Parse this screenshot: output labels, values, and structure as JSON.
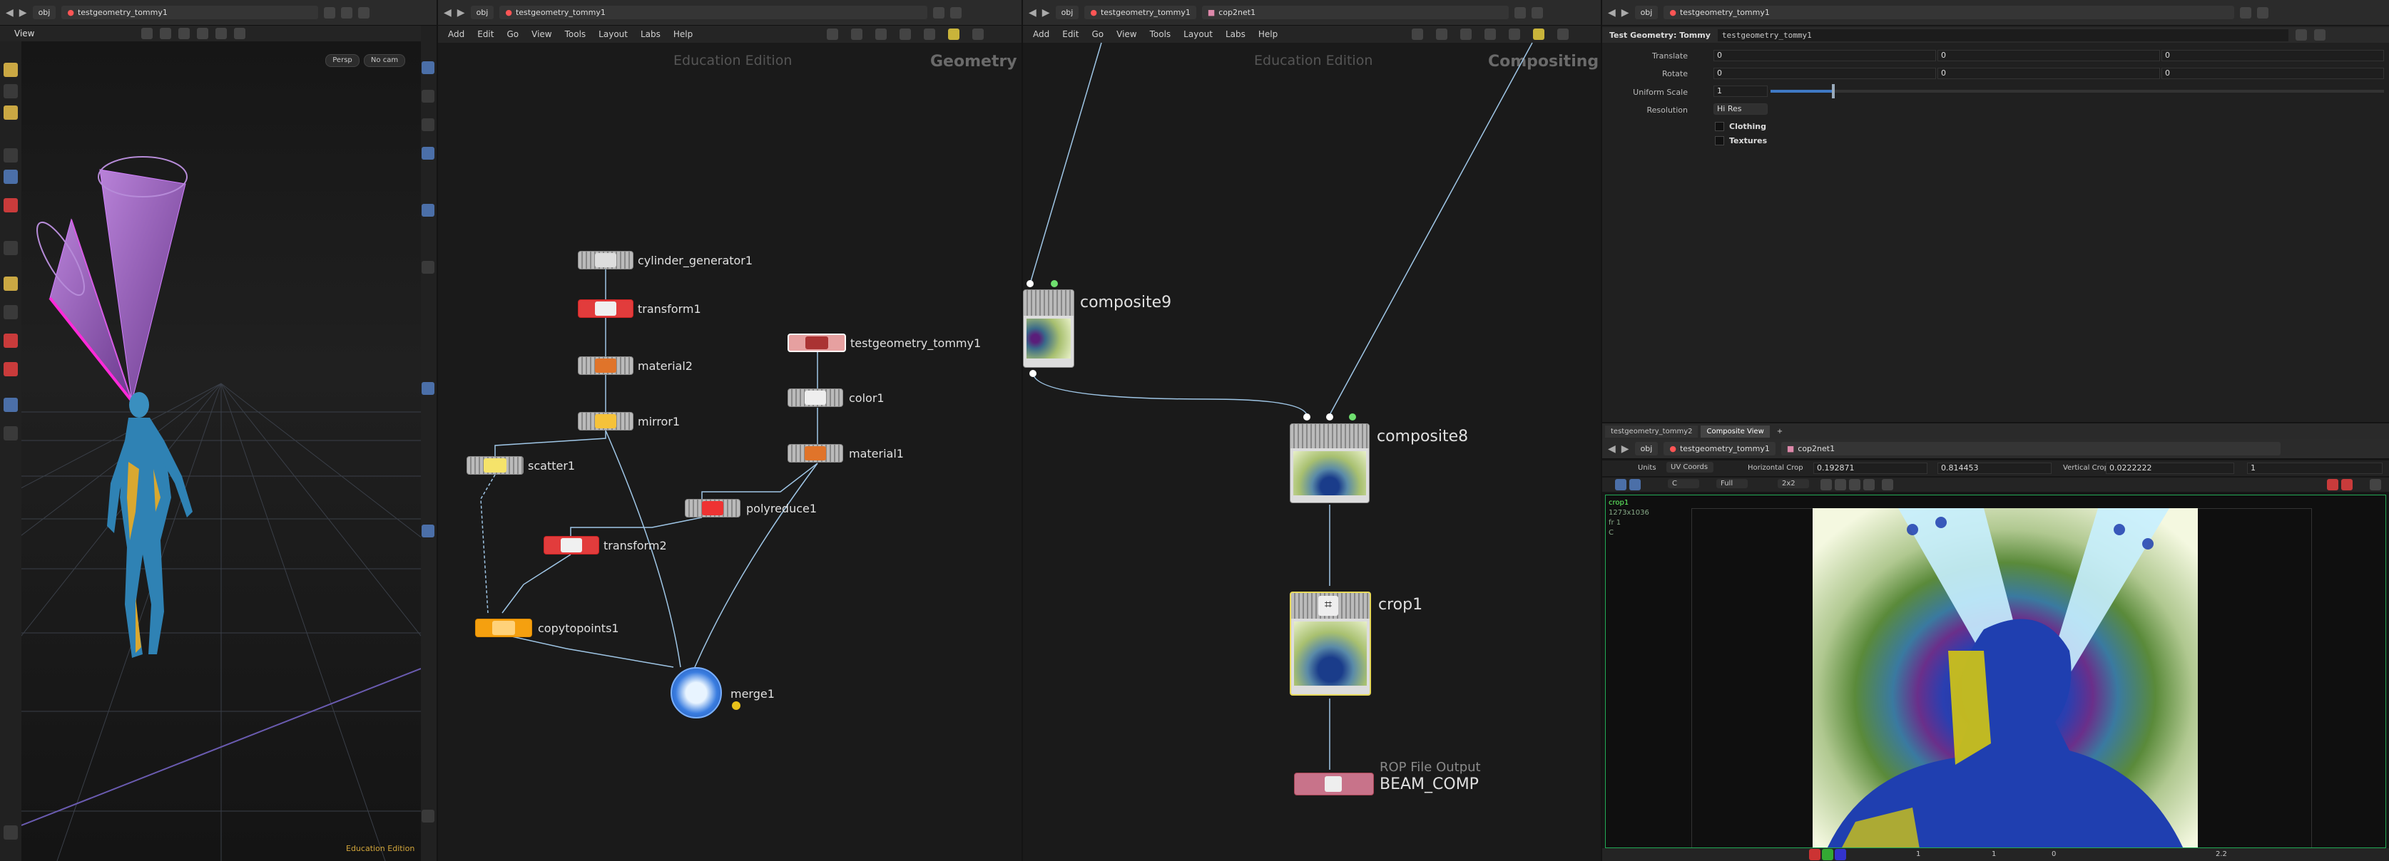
{
  "viewport": {
    "path": {
      "root": "obj",
      "node": "testgeometry_tommy1"
    },
    "title": "View",
    "persp": "Persp",
    "cam": "No cam",
    "edition": "Education Edition"
  },
  "network_geo": {
    "path": {
      "root": "obj",
      "node": "testgeometry_tommy1"
    },
    "menu": [
      "Add",
      "Edit",
      "Go",
      "View",
      "Tools",
      "Layout",
      "Labs",
      "Help"
    ],
    "edition": "Education Edition",
    "context": "Geometry",
    "nodes": {
      "cylinder": "cylinder_generator1",
      "transform1": "transform1",
      "material2": "material2",
      "mirror1": "mirror1",
      "scatter1": "scatter1",
      "transform2": "transform2",
      "copytopoints1": "copytopoints1",
      "merge1": "merge1",
      "testgeo": "testgeometry_tommy1",
      "color1": "color1",
      "material1": "material1",
      "polyreduce1": "polyreduce1"
    }
  },
  "network_comp": {
    "path": {
      "root": "obj",
      "node": "testgeometry_tommy1",
      "net": "cop2net1"
    },
    "menu": [
      "Add",
      "Edit",
      "Go",
      "View",
      "Tools",
      "Layout",
      "Labs",
      "Help"
    ],
    "edition": "Education Edition",
    "context": "Compositing",
    "nodes": {
      "composite9": "composite9",
      "composite8": "composite8",
      "crop1": "crop1",
      "rop_type": "ROP File Output",
      "beam": "BEAM_COMP"
    }
  },
  "params": {
    "path": {
      "root": "obj",
      "node": "testgeometry_tommy1"
    },
    "node_type": "Test Geometry: Tommy",
    "node_name": "testgeometry_tommy1",
    "translate_label": "Translate",
    "translate": [
      "0",
      "0",
      "0"
    ],
    "rotate_label": "Rotate",
    "rotate": [
      "0",
      "0",
      "0"
    ],
    "scale_label": "Uniform Scale",
    "scale": "1",
    "scale_fraction": 0.1,
    "resolution_label": "Resolution",
    "resolution": "Hi Res",
    "clothing": "Clothing",
    "textures": "Textures"
  },
  "composite_view": {
    "tabs": [
      "testgeometry_tommy2",
      "Composite View"
    ],
    "path": {
      "root": "obj",
      "node": "testgeometry_tommy1",
      "net": "cop2net1"
    },
    "units_label": "Units",
    "units": "UV Coords",
    "hcrop_label": "Horizontal Crop",
    "hcrop": [
      "0.192871",
      "0.814453"
    ],
    "vcrop_label": "Vertical Crop",
    "vcrop": [
      "0.0222222",
      "1"
    ],
    "channel": "C",
    "full": "Full",
    "ratio": "2x2",
    "info": [
      "crop1",
      "1273x1036",
      "fr 1",
      "C"
    ],
    "footer": [
      "1",
      "1",
      "0",
      "2.2"
    ]
  },
  "colors": {
    "bg": "#1b1b1b",
    "red_node": "#e23c3c",
    "orange_node": "#f5a00f",
    "pink_node": "#e6a0a0",
    "rop_node": "#c8738a",
    "wire": "#5aa8e0",
    "highlight": "#e6d85a"
  }
}
